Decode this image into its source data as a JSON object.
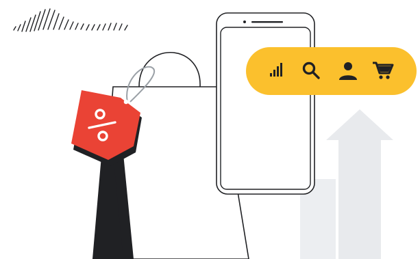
{
  "illustration": {
    "colors": {
      "background": "#ffffff",
      "outline": "#202124",
      "shadow": "#202124",
      "accent_yellow": "#fbc02d",
      "sale_tag_red": "#ea4335",
      "arrow_gray": "#e8eaed",
      "tag_string_gray": "#9aa0a6"
    },
    "phone": {
      "speaker": "speaker-slot",
      "camera": "front-camera"
    },
    "search_bar": {
      "icons": [
        "signal-bars-icon",
        "search-icon",
        "person-icon",
        "shopping-cart-icon"
      ]
    },
    "sale_tag": {
      "symbol": "percent-icon"
    }
  }
}
